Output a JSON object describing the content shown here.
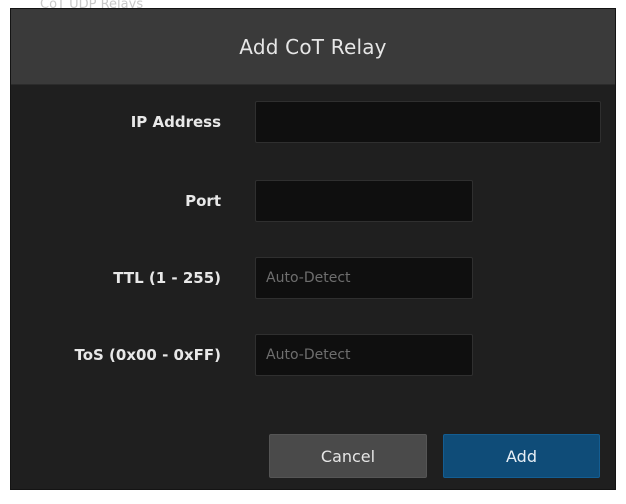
{
  "background_hint": "CoT UDP Relays",
  "dialog": {
    "title": "Add CoT Relay",
    "fields": {
      "ip_address": {
        "label": "IP Address",
        "value": "",
        "placeholder": ""
      },
      "port": {
        "label": "Port",
        "value": "",
        "placeholder": ""
      },
      "ttl": {
        "label": "TTL (1 - 255)",
        "value": "",
        "placeholder": "Auto-Detect"
      },
      "tos": {
        "label": "ToS (0x00 - 0xFF)",
        "value": "",
        "placeholder": "Auto-Detect"
      }
    },
    "buttons": {
      "cancel": "Cancel",
      "add": "Add"
    }
  },
  "colors": {
    "header_bg": "#3a3a3a",
    "body_bg": "#1f1f1f",
    "input_bg": "#0f0f0f",
    "primary_button": "#0f4c78",
    "secondary_button": "#4a4a4a"
  }
}
